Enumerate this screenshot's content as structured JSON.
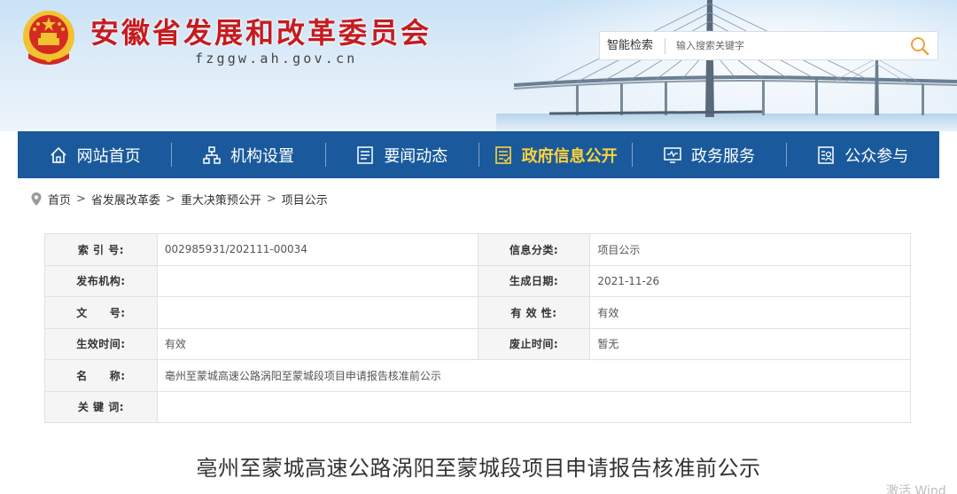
{
  "header": {
    "title": "安徽省发展和改革委员会",
    "domain": "fzggw.ah.gov.cn"
  },
  "search": {
    "label": "智能检索",
    "placeholder": "输入搜索关键字",
    "icon": "search-icon"
  },
  "nav": {
    "items": [
      {
        "label": "网站首页",
        "icon": "home-icon",
        "active": false
      },
      {
        "label": "机构设置",
        "icon": "org-chart-icon",
        "active": false
      },
      {
        "label": "要闻动态",
        "icon": "news-icon",
        "active": false
      },
      {
        "label": "政府信息公开",
        "icon": "info-disclosure-icon",
        "active": true
      },
      {
        "label": "政务服务",
        "icon": "service-monitor-icon",
        "active": false
      },
      {
        "label": "公众参与",
        "icon": "public-participation-icon",
        "active": false
      }
    ],
    "colors": {
      "background": "#1a5a9c",
      "active": "#ffd23a"
    }
  },
  "breadcrumb": {
    "icon": "location-pin-icon",
    "items": [
      "首页",
      "省发展改革委",
      "重大决策预公开",
      "项目公示"
    ],
    "separator": ">"
  },
  "info": {
    "rows": [
      {
        "k1": "索 引 号:",
        "v1": "002985931/202111-00034",
        "k2": "信息分类:",
        "v2": "项目公示"
      },
      {
        "k1": "发布机构:",
        "v1": "",
        "k2": "生成日期:",
        "v2": "2021-11-26"
      },
      {
        "k1": "文　　号:",
        "v1": "",
        "k2": "有 效 性:",
        "v2": "有效"
      },
      {
        "k1": "生效时间:",
        "v1": "有效",
        "k2": "废止时间:",
        "v2": "暂无"
      }
    ],
    "name_label": "名　　称:",
    "name_value": "亳州至蒙城高速公路涡阳至蒙城段项目申请报告核准前公示",
    "keyword_label": "关 键 词:",
    "keyword_value": ""
  },
  "article": {
    "title": "亳州至蒙城高速公路涡阳至蒙城段项目申请报告核准前公示"
  },
  "watermark": "激活 Wind"
}
